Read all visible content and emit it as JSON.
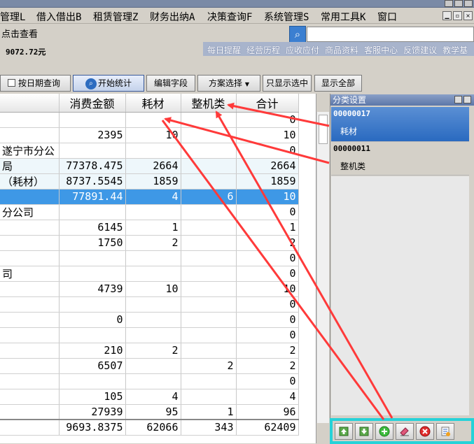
{
  "menu": {
    "items": [
      "管理L",
      "借入借出B",
      "租赁管理Z",
      "财务出纳A",
      "决策查询F",
      "系统管理S",
      "常用工具K",
      "窗口"
    ]
  },
  "toolbar": {
    "hint": "点击查看",
    "balance": "9072.72元",
    "links": [
      "每日提醒",
      "经营历程",
      "应收应付",
      "商品资料",
      "客服中心",
      "反馈建议",
      "教学基"
    ]
  },
  "buttons": {
    "date_query": "按日期查询",
    "start_stats": "开始统计",
    "edit_fields": "编辑字段",
    "plan_select": "方案选择",
    "only_selected": "只显示选中",
    "show_all": "显示全部"
  },
  "grid": {
    "columns": [
      "",
      "消费金额",
      "耗材",
      "整机类",
      "合计"
    ],
    "rows": [
      [
        "",
        "",
        "",
        "",
        "0"
      ],
      [
        "",
        "2395",
        "10",
        "",
        "10"
      ],
      [
        "遂宁市分公",
        "",
        "",
        "",
        "0"
      ],
      [
        "局",
        "77378.475",
        "2664",
        "",
        "2664"
      ],
      [
        "（耗材）",
        "8737.5545",
        "1859",
        "",
        "1859"
      ],
      [
        "",
        "77891.44",
        "4",
        "6",
        "10"
      ],
      [
        "分公司",
        "",
        "",
        "",
        "0"
      ],
      [
        "",
        "6145",
        "1",
        "",
        "1"
      ],
      [
        "",
        "1750",
        "2",
        "",
        "2"
      ],
      [
        "",
        "",
        "",
        "",
        "0"
      ],
      [
        "司",
        "",
        "",
        "",
        "0"
      ],
      [
        "",
        "4739",
        "10",
        "",
        "10"
      ],
      [
        "",
        "",
        "",
        "",
        "0"
      ],
      [
        "",
        "0",
        "",
        "",
        "0"
      ],
      [
        "",
        "",
        "",
        "",
        "0"
      ],
      [
        "",
        "210",
        "2",
        "",
        "2"
      ],
      [
        "",
        "6507",
        "",
        "2",
        "2"
      ],
      [
        "",
        "",
        "",
        "",
        "0"
      ],
      [
        "",
        "105",
        "4",
        "",
        "4"
      ],
      [
        "",
        "27939",
        "95",
        "1",
        "96"
      ]
    ],
    "selected_row": 5,
    "light_rows": [
      3,
      4
    ],
    "footer": [
      "",
      "9693.8375",
      "62066",
      "343",
      "62409"
    ]
  },
  "panel": {
    "title": "分类设置",
    "items": [
      {
        "code": "00000017",
        "name": "耗材"
      },
      {
        "code": "00000011",
        "name": "整机类"
      }
    ]
  },
  "iconbar": {
    "icons": [
      "move-up-icon",
      "move-down-icon",
      "add-icon",
      "edit-icon",
      "delete-icon",
      "settings-icon"
    ]
  },
  "colors": {
    "selection": "#3e98e6",
    "annotation_arrow": "#ff3a3a",
    "iconbar_highlight": "#26d2d8"
  }
}
